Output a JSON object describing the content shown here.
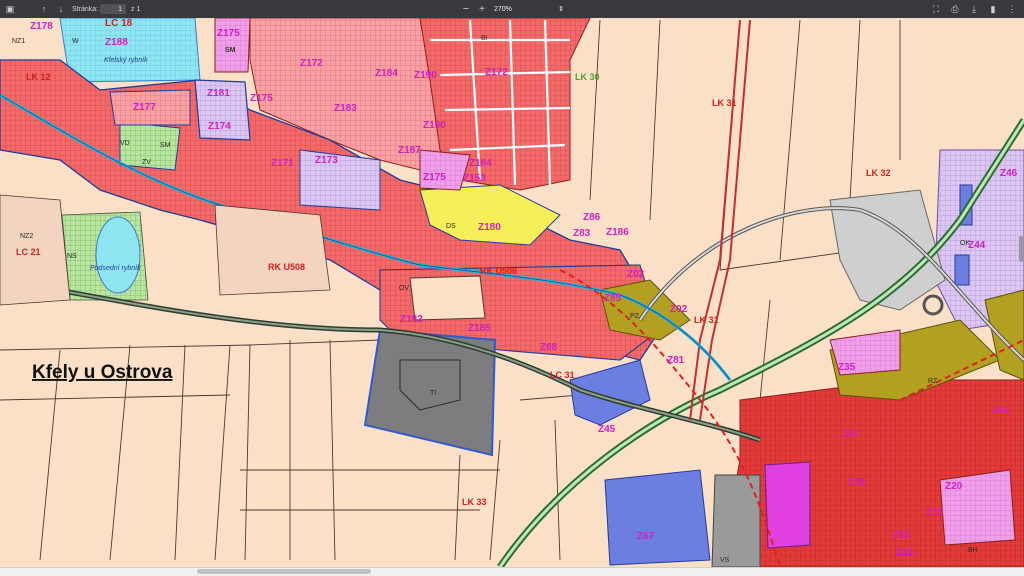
{
  "toolbar": {
    "page_label": "Stránka:",
    "page_value": "1",
    "page_total": "z 1",
    "zoom_value": "270%",
    "zoom_out": "−",
    "zoom_in": "+"
  },
  "map": {
    "place_name": "Kfely u Ostrova",
    "zones": [
      "Z178",
      "LC 18",
      "Z188",
      "Z175",
      "SM",
      "Z172",
      "Z184",
      "Z190",
      "Z172",
      "LK 30",
      "LK 12",
      "Z177",
      "Z181",
      "Z175",
      "Z183",
      "Z174",
      "Z171",
      "Z173",
      "Z187",
      "Z175",
      "Z153",
      "Z184",
      "Z190",
      "LK 31",
      "LK 32",
      "Z46",
      "Z180",
      "Z86",
      "Z83",
      "Z186",
      "Z02",
      "Z85",
      "Z02",
      "LK 31",
      "Z44",
      "LC 21",
      "RK U508",
      "RK U508",
      "Z182",
      "Z185",
      "Z68",
      "LC 31",
      "Z81",
      "Z35",
      "Z55",
      "Z45",
      "Z47",
      "Z03",
      "Z20",
      "Z15",
      "Z16",
      "Z67",
      "LK 33",
      "Z16"
    ],
    "codes": [
      "NZ1",
      "NZ2",
      "NS",
      "W",
      "SM",
      "DS",
      "ZV",
      "VD",
      "BI",
      "OV",
      "PZ",
      "TI",
      "RZ",
      "OK",
      "VS",
      "BH"
    ],
    "water_labels": [
      "Kfelský rybník",
      "Podsední rybník"
    ]
  }
}
